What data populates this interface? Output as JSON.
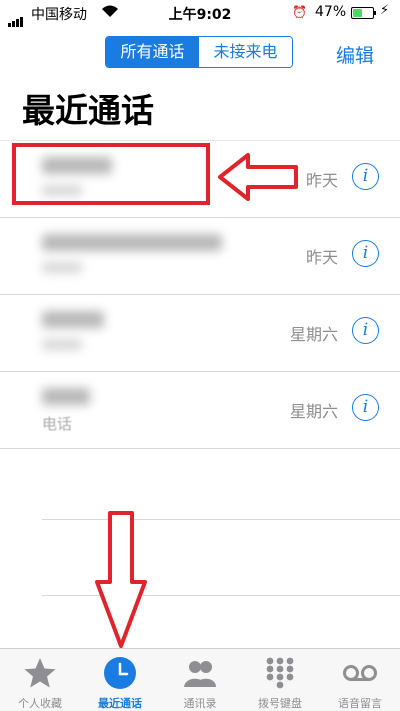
{
  "status": {
    "carrier": "中国移动",
    "time": "上午9:02",
    "battery_pct": "47%",
    "battery_level": 0.47
  },
  "nav": {
    "seg_all": "所有通话",
    "seg_missed": "未接来电",
    "edit": "编辑"
  },
  "title": "最近通话",
  "calls": [
    {
      "date": "昨天",
      "sub": ""
    },
    {
      "date": "昨天",
      "sub": ""
    },
    {
      "date": "星期六",
      "sub": ""
    },
    {
      "date": "星期六",
      "sub": "电话"
    }
  ],
  "tabs": [
    {
      "label": "个人收藏",
      "icon": "star-icon"
    },
    {
      "label": "最近通话",
      "icon": "clock-icon"
    },
    {
      "label": "通讯录",
      "icon": "contacts-icon"
    },
    {
      "label": "拨号键盘",
      "icon": "keypad-icon"
    },
    {
      "label": "语音留言",
      "icon": "voicemail-icon"
    }
  ],
  "colors": {
    "accent": "#1a7ce0",
    "annotation": "#e0242b"
  }
}
